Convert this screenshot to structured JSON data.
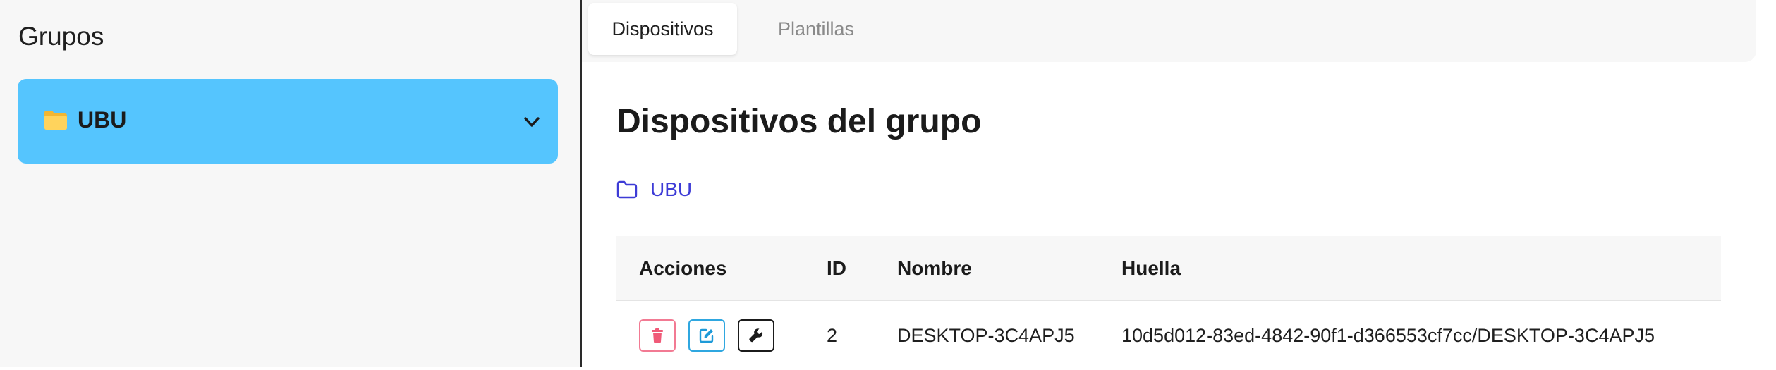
{
  "sidebar": {
    "title": "Grupos",
    "groups": [
      {
        "label": "UBU",
        "expanded": false
      }
    ]
  },
  "tabs": [
    {
      "label": "Dispositivos",
      "active": true
    },
    {
      "label": "Plantillas",
      "active": false
    }
  ],
  "main": {
    "page_title": "Dispositivos del grupo",
    "breadcrumb": {
      "label": "UBU"
    }
  },
  "table": {
    "headers": [
      "Acciones",
      "ID",
      "Nombre",
      "Huella"
    ],
    "rows": [
      {
        "id": "2",
        "name": "DESKTOP-3C4APJ5",
        "hash": "10d5d012-83ed-4842-90f1-d366553cf7cc/DESKTOP-3C4APJ5",
        "actions": [
          "trash-icon",
          "edit-icon",
          "wrench-icon"
        ]
      }
    ]
  },
  "colors": {
    "group_highlight": "#55c5fe",
    "link": "#3d3bd6",
    "delete_border": "#f27a93",
    "delete_icon": "#f05a78",
    "edit_border": "#2fa7e0",
    "edit_icon": "#1e9ad8",
    "config_border": "#1b1b1b",
    "folder_fill": "#ffcf4d"
  }
}
